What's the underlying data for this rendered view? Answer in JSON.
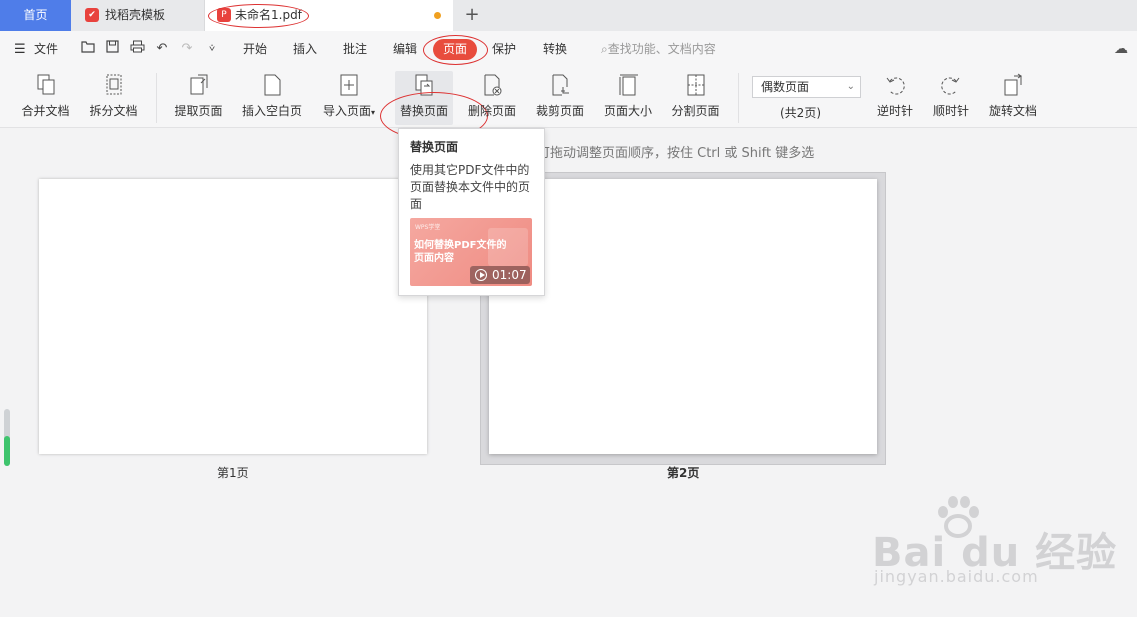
{
  "tabs": {
    "home": "首页",
    "templates": "找稻壳模板",
    "document": "未命名1.pdf",
    "new_tab": "+"
  },
  "menu": {
    "file": "文件",
    "items": [
      "开始",
      "插入",
      "批注",
      "编辑",
      "页面",
      "保护",
      "转换"
    ],
    "active": "页面",
    "search_placeholder": "查找功能、文档内容"
  },
  "ribbon": {
    "buttons": [
      "合并文档",
      "拆分文档",
      "提取页面",
      "插入空白页",
      "导入页面",
      "替换页面",
      "删除页面",
      "裁剪页面",
      "页面大小",
      "分割页面",
      "逆时针",
      "顺时针",
      "旋转文档"
    ],
    "page_select_value": "偶数页面",
    "page_count": "(共2页)"
  },
  "tooltip": {
    "title": "替换页面",
    "description": "使用其它PDF文件中的页面替换本文件中的页面",
    "thumb_brand": "WPS学堂",
    "thumb_caption": "如何替换PDF文件的页面内容",
    "duration": "01:07"
  },
  "workspace": {
    "hint": "可拖动调整页面顺序，按住 Ctrl 或 Shift 键多选",
    "page1_label": "第1页",
    "page2_label": "第2页"
  },
  "watermark": {
    "brand": "Bai  du 经验",
    "url": "jingyan.baidu.com"
  },
  "colors": {
    "accent_blue": "#4f7de9",
    "accent_red": "#e84c3d",
    "pdf_icon": "#e8423d"
  }
}
